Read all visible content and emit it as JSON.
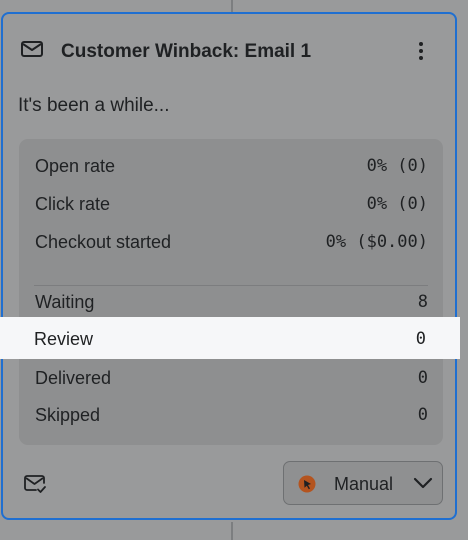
{
  "card": {
    "title": "Customer Winback: Email 1",
    "subject": "It's been a while...",
    "header_icon": "mail-icon",
    "menu_icon": "kebab-menu-icon"
  },
  "metrics": [
    {
      "label": "Open rate",
      "value": "0% (0)"
    },
    {
      "label": "Click rate",
      "value": "0% (0)"
    },
    {
      "label": "Checkout started",
      "value": "0% ($0.00)"
    }
  ],
  "statuses": [
    {
      "label": "Waiting",
      "value": "8"
    },
    {
      "label": "Review",
      "value": "0"
    },
    {
      "label": "Delivered",
      "value": "0"
    },
    {
      "label": "Skipped",
      "value": "0"
    }
  ],
  "footer": {
    "status_icon": "mail-check-icon",
    "mode": {
      "label": "Manual",
      "icon": "cursor-click-icon",
      "icon_color": "#b4541f",
      "chevron": "chevron-down-icon"
    }
  },
  "colors": {
    "selection_border": "#1f6fd1",
    "highlight_row": "#f6f7f9"
  }
}
